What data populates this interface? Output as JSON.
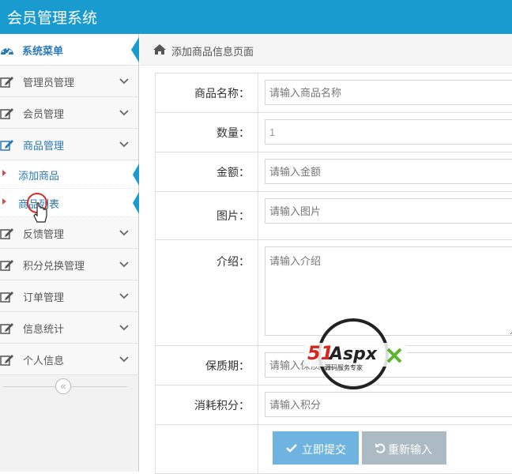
{
  "app": {
    "title": "会员管理系统"
  },
  "sidebar": {
    "header": {
      "label": "系统菜单",
      "icon": "dashboard-icon"
    },
    "items": [
      {
        "label": "管理员管理",
        "icon": "edit-icon"
      },
      {
        "label": "会员管理",
        "icon": "edit-icon"
      },
      {
        "label": "商品管理",
        "icon": "edit-icon",
        "expanded": true
      }
    ],
    "subitems": [
      {
        "label": "添加商品"
      },
      {
        "label": "商品列表"
      }
    ],
    "items_after": [
      {
        "label": "反馈管理",
        "icon": "edit-icon"
      },
      {
        "label": "积分兑换管理",
        "icon": "edit-icon"
      },
      {
        "label": "订单管理",
        "icon": "edit-icon"
      },
      {
        "label": "信息统计",
        "icon": "edit-icon"
      },
      {
        "label": "个人信息",
        "icon": "edit-icon"
      }
    ],
    "collapse_icon": "double-chevron-left-icon"
  },
  "breadcrumb": {
    "text": "添加商品信息页面",
    "icon": "home-icon"
  },
  "form": {
    "name": {
      "label": "商品名称：",
      "placeholder": "请输入商品名称"
    },
    "quantity": {
      "label": "数量：",
      "value": "1"
    },
    "amount": {
      "label": "金额：",
      "placeholder": "请输入金额"
    },
    "image": {
      "label": "图片：",
      "placeholder": "请输入图片"
    },
    "intro": {
      "label": "介绍：",
      "placeholder": "请输入介绍"
    },
    "shelf_life": {
      "label": "保质期：",
      "placeholder": "请输入保质期"
    },
    "points": {
      "label": "消耗积分：",
      "placeholder": "请输入积分"
    },
    "submit_label": "立即提交",
    "reset_label": "重新输入"
  },
  "watermark": {
    "brand": "51Aspx",
    "slogan": "源码服务专家"
  },
  "colors": {
    "topbar": "#1a9bd0",
    "link": "#2a7ab8",
    "submit": "#6fb3e0",
    "reset": "#abbac3"
  }
}
